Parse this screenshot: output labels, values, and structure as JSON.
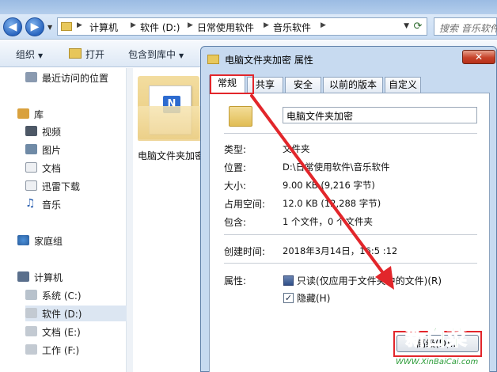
{
  "explorer": {
    "nav": {
      "back_icon": "back-arrow-icon",
      "forward_icon": "forward-arrow-icon"
    },
    "breadcrumb": [
      "计算机",
      "软件 (D:)",
      "日常使用软件",
      "音乐软件"
    ],
    "search_placeholder": "搜索 音乐软件",
    "toolbar": {
      "organize": "组织",
      "open": "打开",
      "include_in_library": "包含到库中"
    },
    "sidebar": {
      "recent": "最近访问的位置",
      "libraries": "库",
      "library_items": [
        "视频",
        "图片",
        "文档",
        "迅雷下载",
        "音乐"
      ],
      "homegroup": "家庭组",
      "computer": "计算机",
      "drives": [
        "系统 (C:)",
        "软件 (D:)",
        "文档 (E:)",
        "工作 (F:)"
      ]
    },
    "file_item_label": "电脑文件夹加密"
  },
  "dialog": {
    "title": "电脑文件夹加密 属性",
    "close_label": "✕",
    "tabs": [
      "常规",
      "共享",
      "安全",
      "以前的版本",
      "自定义"
    ],
    "active_tab": "常规",
    "folder_name": "电脑文件夹加密",
    "rows": [
      {
        "label": "类型:",
        "value": "文件夹"
      },
      {
        "label": "位置:",
        "value": "D:\\日常使用软件\\音乐软件"
      },
      {
        "label": "大小:",
        "value": "9.00 KB (9,216 字节)"
      },
      {
        "label": "占用空间:",
        "value": "12.0 KB (12,288 字节)"
      },
      {
        "label": "包含:",
        "value": "1 个文件，0 个文件夹"
      },
      {
        "label": "创建时间:",
        "value": "2018年3月14日，16:5 :12"
      }
    ],
    "attributes_label": "属性:",
    "readonly_label": "只读(仅应用于文件夹中的文件)(R)",
    "hidden_label": "隐藏(H)",
    "hidden_checked": true,
    "advanced_button": "高级(D)..."
  },
  "annotation": {
    "color": "#e2262b"
  },
  "watermark": {
    "text": "新白菜",
    "url": "WWW.XinBaiCai.com",
    "color": "#2e9d3a"
  }
}
